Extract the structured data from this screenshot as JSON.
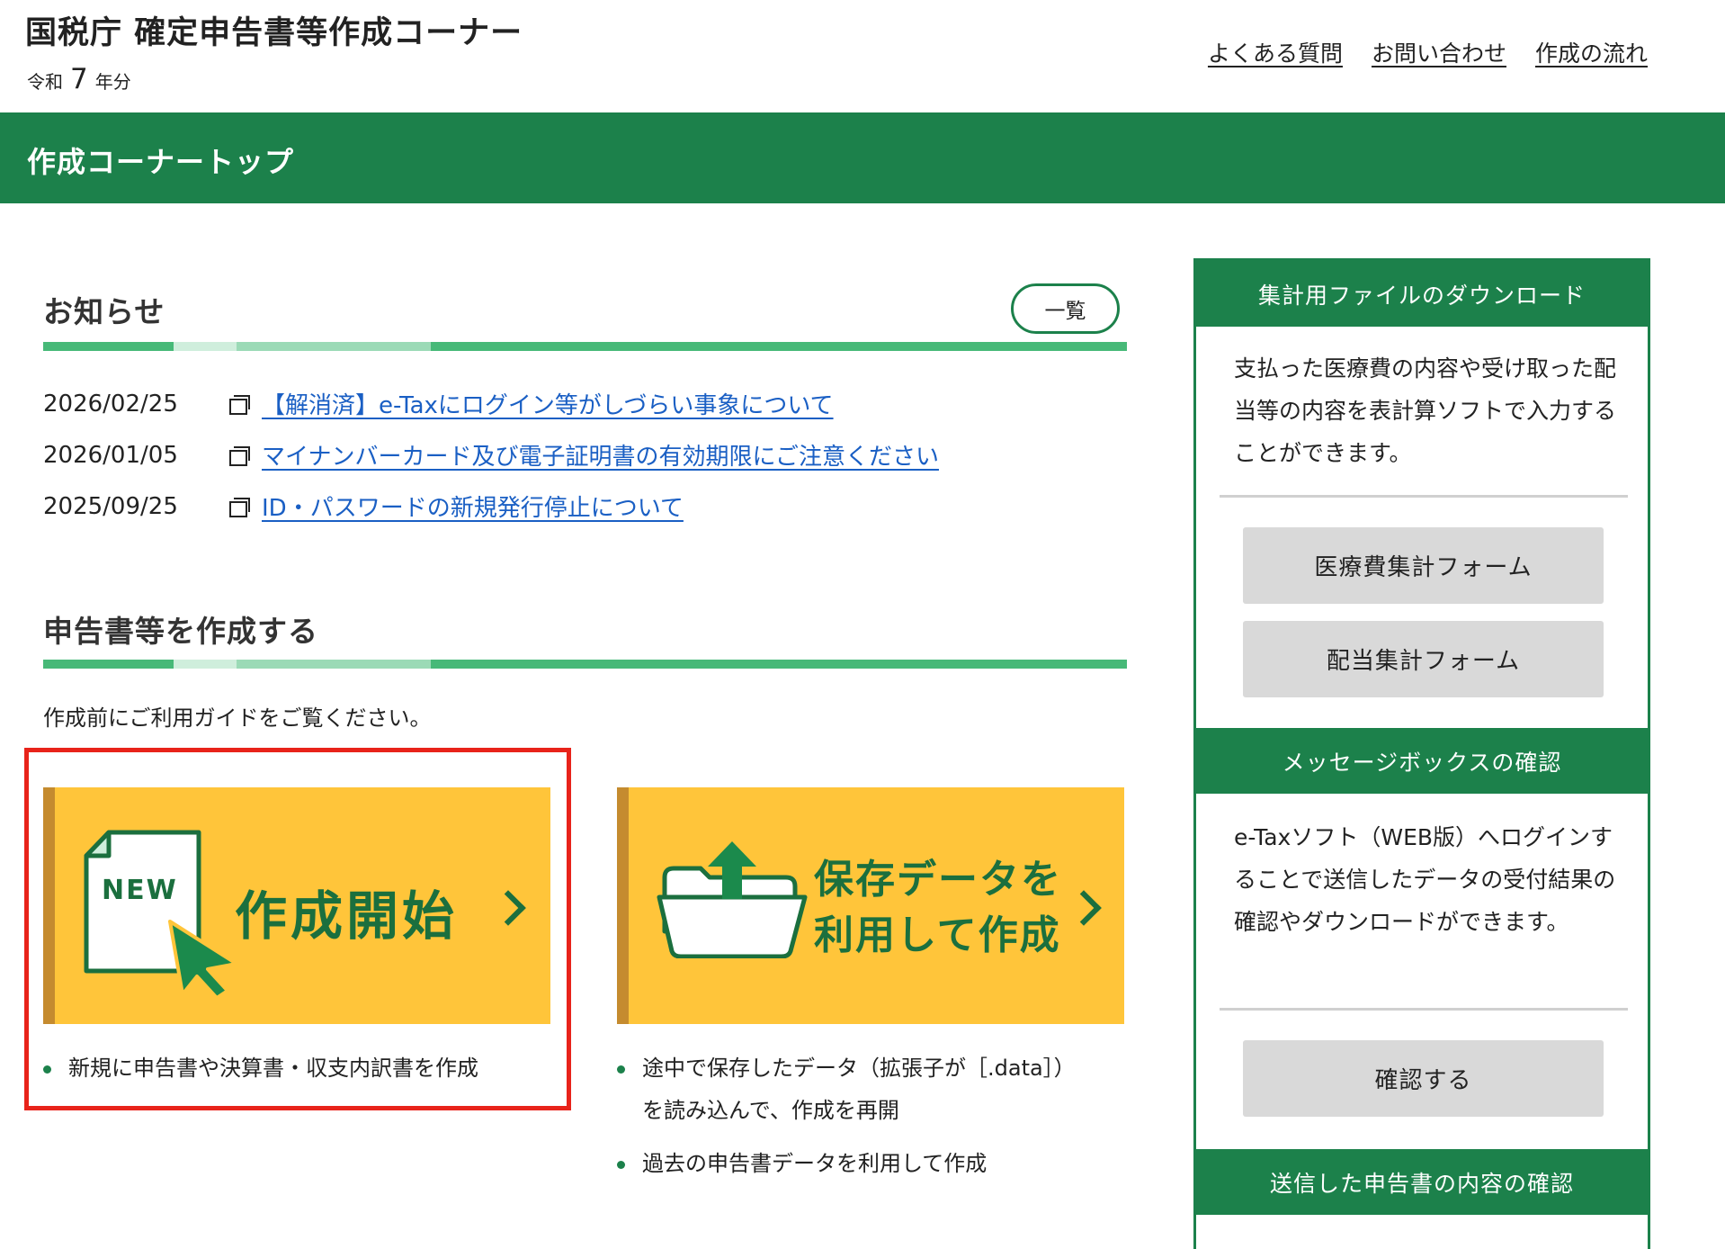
{
  "header": {
    "site_title": "国税庁 確定申告書等作成コーナー",
    "year_prefix": "令和",
    "year_number": "7",
    "year_suffix": "年分",
    "links": [
      "よくある質問",
      "お問い合わせ",
      "作成の流れ"
    ]
  },
  "page_bar": {
    "title": "作成コーナートップ"
  },
  "news": {
    "heading": "お知らせ",
    "list_button": "一覧",
    "items": [
      {
        "date": "2026/02/25",
        "title": "【解消済】e-Taxにログイン等がしづらい事象について"
      },
      {
        "date": "2026/01/05",
        "title": "マイナンバーカード及び電子証明書の有効期限にご注意ください"
      },
      {
        "date": "2025/09/25",
        "title": "ID・パスワードの新規発行停止について"
      }
    ]
  },
  "create": {
    "heading": "申告書等を作成する",
    "guide_text": "作成前にご利用ガイドをご覧ください。",
    "new_card": {
      "badge": "NEW",
      "title": "作成開始",
      "bullets": [
        "新規に申告書や決算書・収支内訳書を作成"
      ]
    },
    "saved_card": {
      "title_line1": "保存データを",
      "title_line2": "利用して作成",
      "bullets": [
        "途中で保存したデータ（拡張子が［.data］）",
        "を読み込んで、作成を再開",
        "過去の申告書データを利用して作成"
      ]
    }
  },
  "sidebar": {
    "download": {
      "header": "集計用ファイルのダウンロード",
      "text": "支払った医療費の内容や受け取った配当等の内容を表計算ソフトで入力することができます。",
      "buttons": [
        "医療費集計フォーム",
        "配当集計フォーム"
      ]
    },
    "message_box": {
      "header": "メッセージボックスの確認",
      "text": "e-Taxソフト（WEB版）へログインすることで送信したデータの受付結果の確認やダウンロードができます。",
      "button": "確認する"
    },
    "sent": {
      "header": "送信した申告書の内容の確認"
    }
  },
  "colors": {
    "brand_green": "#1c814b",
    "card_yellow": "#ffc53a",
    "highlight_red": "#e8231a",
    "link_blue": "#1a5fc4"
  }
}
